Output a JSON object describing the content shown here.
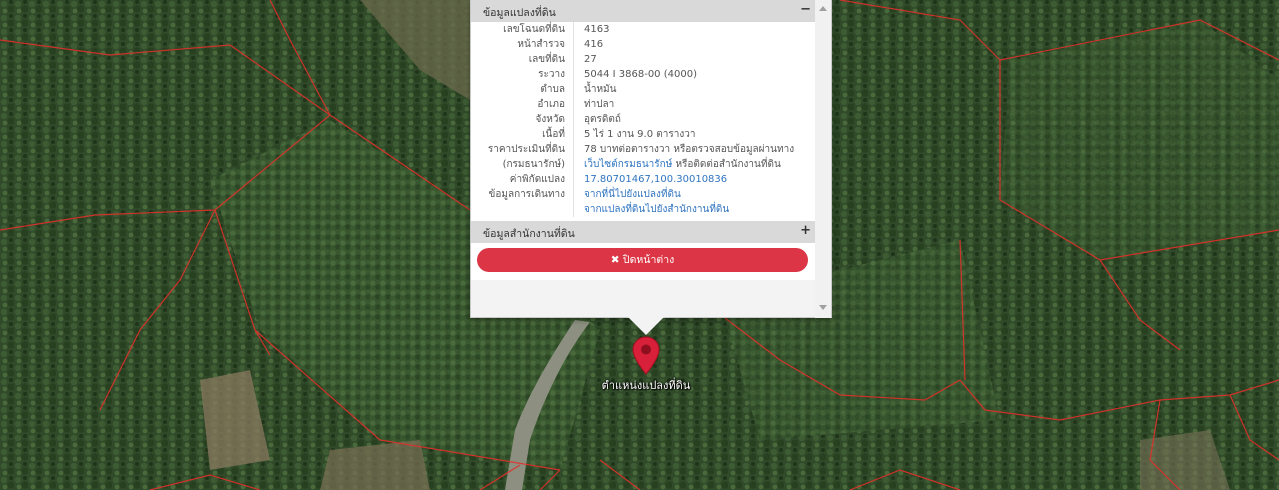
{
  "popup": {
    "header_title": "ข้อมูลแปลงที่ดิน",
    "header_toggle": "−",
    "rows": [
      {
        "label": "เลขโฉนดที่ดิน",
        "value": "4163"
      },
      {
        "label": "หน้าสำรวจ",
        "value": "416"
      },
      {
        "label": "เลขที่ดิน",
        "value": "27"
      },
      {
        "label": "ระวาง",
        "value": "5044 I 3868-00 (4000)"
      },
      {
        "label": "ตำบล",
        "value": "น้ำหมัน"
      },
      {
        "label": "อำเภอ",
        "value": "ท่าปลา"
      },
      {
        "label": "จังหวัด",
        "value": "อุตรดิตถ์"
      },
      {
        "label": "เนื้อที่",
        "value": "5 ไร่ 1 งาน 9.0 ตารางวา"
      },
      {
        "label": "ราคาประเมินที่ดิน",
        "value": "78 บาทต่อตารางวา หรือตรวจสอบข้อมูลผ่านทาง"
      }
    ],
    "appraisal_source_label": "(กรมธนารักษ์)",
    "appraisal_link": "เว็บไซต์กรมธนารักษ์",
    "appraisal_suffix": " หรือติดต่อสำนักงานที่ดิน",
    "coord_label": "ค่าพิกัดแปลง",
    "coord_value": "17.80701467,100.30010836",
    "travel_label": "ข้อมูลการเดินทาง",
    "travel_link_1": "จากที่นี่ไปยังแปลงที่ดิน",
    "travel_link_2": "จากแปลงที่ดินไปยังสำนักงานที่ดิน",
    "office_header": "ข้อมูลสำนักงานที่ดิน",
    "office_toggle": "+",
    "close_button": "✖ ปิดหน้าต่าง"
  },
  "marker": {
    "label": "ตำแหน่งแปลงที่ดิน",
    "color": "#d8203a"
  },
  "map": {
    "boundary_color": "#e0302a",
    "forest_color": "#2e4a28"
  }
}
